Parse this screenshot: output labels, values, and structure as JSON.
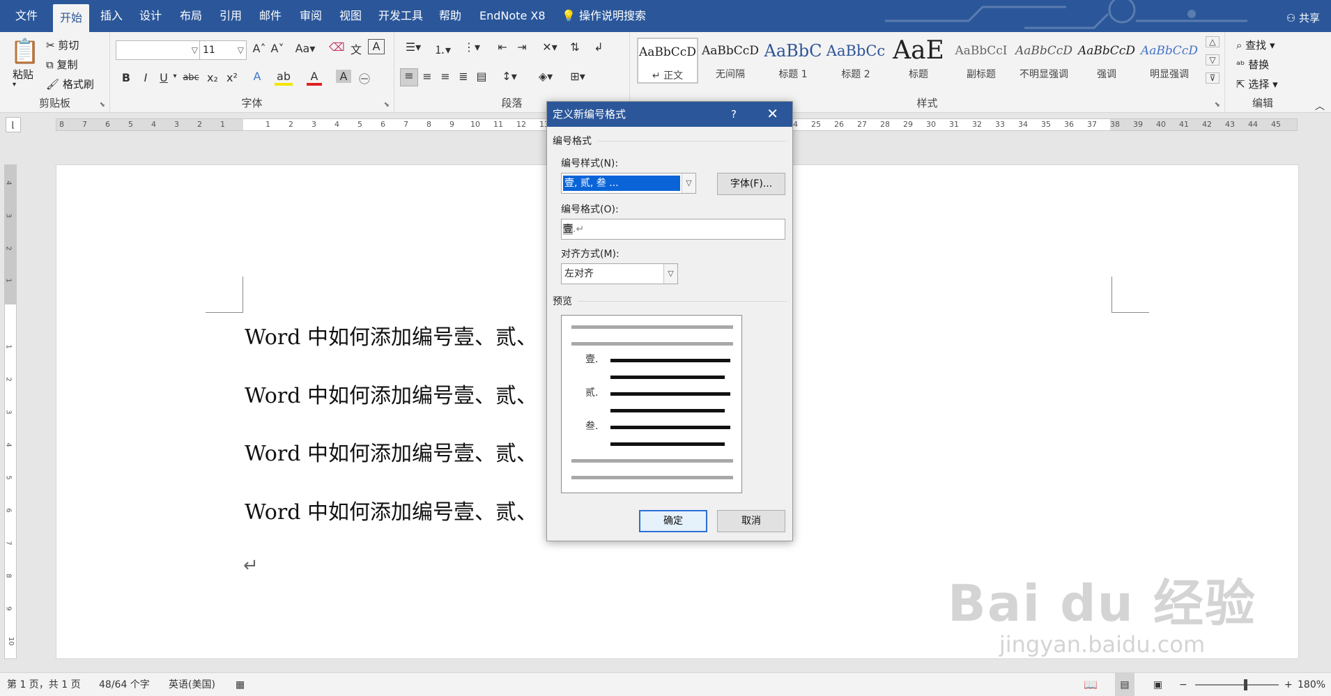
{
  "menu": {
    "tabs": [
      "文件",
      "开始",
      "插入",
      "设计",
      "布局",
      "引用",
      "邮件",
      "审阅",
      "视图",
      "开发工具",
      "帮助",
      "EndNote X8"
    ],
    "active_tab": "开始",
    "search": "操作说明搜索",
    "share": "共享"
  },
  "ribbon": {
    "clipboard": {
      "label": "剪贴板",
      "paste": "粘贴",
      "cut": "剪切",
      "copy": "复制",
      "format_painter": "格式刷"
    },
    "font": {
      "label": "字体",
      "font_name": "",
      "font_size": "11",
      "bold": "B",
      "italic": "I",
      "underline": "U",
      "strike": "abc",
      "sub": "x₂",
      "sup": "x²",
      "case": "Aa"
    },
    "paragraph": {
      "label": "段落"
    },
    "styles": {
      "label": "样式",
      "items": [
        {
          "preview": "AaBbCcD",
          "name": "↵ 正文"
        },
        {
          "preview": "AaBbCcD",
          "name": "无间隔"
        },
        {
          "preview": "AaBbC",
          "name": "标题 1"
        },
        {
          "preview": "AaBbCc",
          "name": "标题 2"
        },
        {
          "preview": "AaE",
          "name": "标题"
        },
        {
          "preview": "AaBbCcI",
          "name": "副标题"
        },
        {
          "preview": "AaBbCcD",
          "name": "不明显强调"
        },
        {
          "preview": "AaBbCcD",
          "name": "强调"
        },
        {
          "preview": "AaBbCcD",
          "name": "明显强调"
        }
      ]
    },
    "editing": {
      "label": "编辑",
      "find": "查找",
      "replace": "替换",
      "select": "选择"
    }
  },
  "ruler": {
    "left_numbers": [
      "8",
      "7",
      "6",
      "5",
      "4",
      "3",
      "2",
      "1"
    ],
    "right_numbers": [
      "1",
      "2",
      "3",
      "4",
      "5",
      "6",
      "7",
      "8",
      "9",
      "10",
      "11",
      "12",
      "13",
      "24",
      "25",
      "26",
      "27",
      "28",
      "29",
      "30",
      "31",
      "32",
      "33",
      "34",
      "35",
      "36",
      "37",
      "38",
      "39",
      "40",
      "41",
      "42",
      "43",
      "44",
      "45"
    ],
    "vertical_numbers": [
      "4",
      "3",
      "2",
      "1",
      "1",
      "1",
      "2",
      "3",
      "4",
      "5",
      "6",
      "7",
      "8",
      "9",
      "10"
    ]
  },
  "document": {
    "lines": [
      "Word 中如何添加编号壹、贰、",
      "Word 中如何添加编号壹、贰、",
      "Word 中如何添加编号壹、贰、",
      "Word 中如何添加编号壹、贰、"
    ],
    "paragraph_mark": "↵",
    "watermark_main": "Bai du 经验",
    "watermark_sub": "jingyan.baidu.com"
  },
  "dialog": {
    "title": "定义新编号格式",
    "help": "?",
    "close": "✕",
    "section_format": "编号格式",
    "style_label": "编号样式(N):",
    "style_value": "壹, 贰, 叁 ...",
    "font_button": "字体(F)...",
    "format_label": "编号格式(O):",
    "format_value": "壹",
    "format_suffix": ".↵",
    "align_label": "对齐方式(M):",
    "align_value": "左对齐",
    "section_preview": "预览",
    "preview_numbers": [
      "壹.",
      "贰.",
      "叁."
    ],
    "ok": "确定",
    "cancel": "取消"
  },
  "status": {
    "page": "第 1 页，共 1 页",
    "words": "48/64 个字",
    "language": "英语(美国)",
    "zoom": "180%"
  },
  "colors": {
    "brand": "#2b579a",
    "selection": "#0a64d8"
  }
}
